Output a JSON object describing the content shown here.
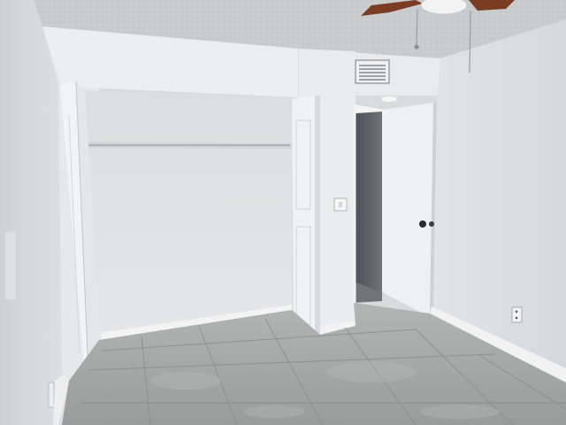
{
  "scene": {
    "subject": "empty-bedroom",
    "palette": {
      "ceiling": "#c9cbcc",
      "wall_left": "#d5d7d8",
      "wall_back": "#e7e9ea",
      "wall_right": "#dfe1e2",
      "closet_interior": "#dadcdd",
      "door_white": "#f1f2f3",
      "dark_hall": "#5e6266",
      "floor_tile": "#a4a6a6",
      "grout": "#8e9090",
      "fan_blade": "#7a3d22",
      "baseboard": "#f4f4f4"
    }
  }
}
